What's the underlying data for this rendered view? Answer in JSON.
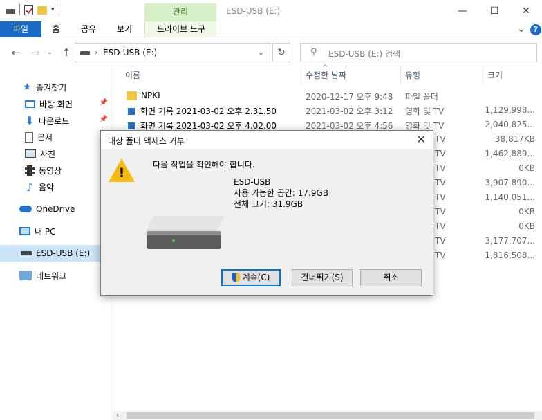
{
  "window": {
    "title": "ESD-USB (E:)",
    "context_tab": "관리",
    "controls": {
      "minimize": "—",
      "maximize": "☐",
      "close": "✕"
    }
  },
  "ribbon": {
    "tabs": [
      "파일",
      "홈",
      "공유",
      "보기"
    ],
    "context_subtab": "드라이브 도구",
    "expand": "⌄",
    "help": "?"
  },
  "address": {
    "path": "ESD-USB (E:)",
    "search_placeholder": "ESD-USB (E:) 검색"
  },
  "sidebar": {
    "quick_access": "즐겨찾기",
    "items": [
      "바탕 화면",
      "다운로드",
      "문서",
      "사진",
      "동영상",
      "음악"
    ],
    "onedrive": "OneDrive",
    "this_pc": "내 PC",
    "usb": "ESD-USB (E:)",
    "network": "네트워크"
  },
  "columns": {
    "name": "이름",
    "date": "수정한 날짜",
    "type": "유형",
    "size": "크기"
  },
  "files": [
    {
      "name": "NPKI",
      "date": "2020-12-17 오후 9:48",
      "type": "파일 폴더",
      "size": "",
      "icon": "folder"
    },
    {
      "name": "화면 기록 2021-03-02 오후 2.31.50",
      "date": "2021-03-02 오후 3:12",
      "type": "영화 및 TV",
      "size": "1,129,998...",
      "icon": "video"
    },
    {
      "name": "화면 기록 2021-03-02 오후 4.02.00",
      "date": "2021-03-02 오후 4:56",
      "type": "영화 및 TV",
      "size": "2,040,825...",
      "icon": "video"
    },
    {
      "type": "TV",
      "size": "38,817KB"
    },
    {
      "type": "TV",
      "size": "1,462,889..."
    },
    {
      "type": "TV",
      "size": "0KB"
    },
    {
      "type": "TV",
      "size": "3,907,890..."
    },
    {
      "type": "TV",
      "size": "1,140,051..."
    },
    {
      "type": "TV",
      "size": "0KB"
    },
    {
      "type": "TV",
      "size": "0KB"
    },
    {
      "type": "TV",
      "size": "3,177,707..."
    },
    {
      "type": "TV",
      "size": "1,816,508..."
    }
  ],
  "dialog": {
    "title": "대상 폴더 액세스 거부",
    "message": "다음 작업을 확인해야 합니다.",
    "drive_name": "ESD-USB",
    "free_space": "사용 가능한 공간: 17.9GB",
    "total_size": "전체 크기: 31.9GB",
    "buttons": {
      "continue": "계속(C)",
      "skip": "건너뛰기(S)",
      "cancel": "취소"
    }
  }
}
